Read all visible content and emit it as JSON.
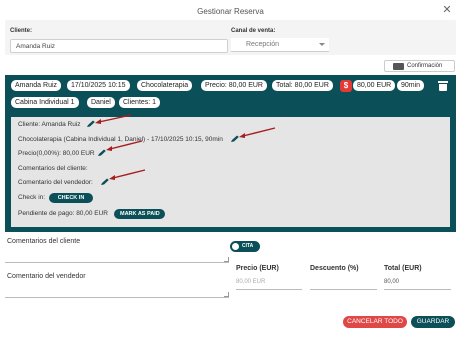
{
  "dialog": {
    "title": "Gestionar Reserva"
  },
  "form": {
    "cliente_label": "Cliente:",
    "cliente_value": "Amanda Ruiz",
    "canal_label": "Canal de venta:",
    "canal_value": "Recepción"
  },
  "confirm_button": "Confirmación",
  "chips": {
    "client": "Amanda Ruiz",
    "datetime": "17/10/2025 10:15",
    "service": "Chocolaterapia",
    "price": "Precio: 80,00 EUR",
    "total": "Total: 80,00 EUR",
    "paid_amount": "80,00 EUR",
    "duration": "90min",
    "cabin": "Cabina Individual 1",
    "staff": "Daniel",
    "clients": "Clientes: 1"
  },
  "detail": {
    "cliente": "Cliente: Amanda Ruiz",
    "servicio": "Chocolaterapia (Cabina Individual 1, Daniel) - 17/10/2025 10:15, 90min",
    "precio": "Precio(0,00%): 80,00 EUR",
    "comentarios_cliente": "Comentarios del cliente:",
    "comentario_vendedor": "Comentario del vendedor:",
    "checkin_label": "Check in:",
    "checkin_button": "CHECK IN",
    "pendiente": "Pendiente de pago:  80,00 EUR",
    "mark_paid_button": "MARK AS PAID"
  },
  "comments": {
    "cliente_label": "Comentarios del cliente",
    "vendedor_label": "Comentario del vendedor"
  },
  "cita_toggle": "CITA",
  "totals": {
    "precio_header": "Precio (EUR)",
    "descuento_header": "Descuento (%)",
    "total_header": "Total (EUR)",
    "precio_value": "80,00 EUR",
    "descuento_value": "",
    "total_value": "80,00"
  },
  "footer": {
    "cancel": "CANCELAR TODO",
    "save": "GUARDAR"
  },
  "colors": {
    "primary": "#0b4f58",
    "danger": "#e04848",
    "arrow": "#a81d1d"
  }
}
